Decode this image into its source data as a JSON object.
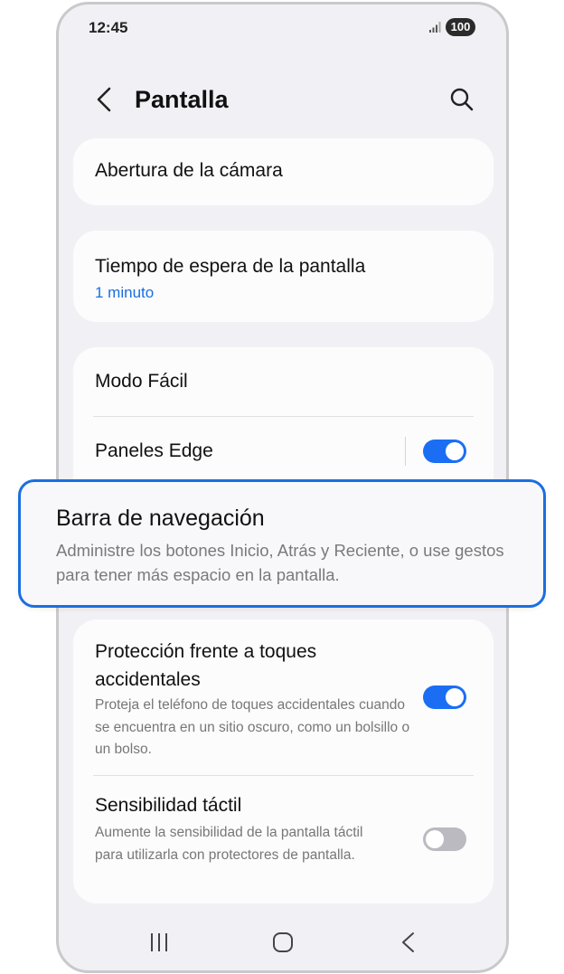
{
  "status_bar": {
    "time": "12:45",
    "battery": "100",
    "signal_icon": "signal-icon"
  },
  "header": {
    "title": "Pantalla",
    "back_icon": "back-icon",
    "search_icon": "search-icon"
  },
  "settings": {
    "camera_cutout": {
      "title": "Abertura de la cámara"
    },
    "screen_timeout": {
      "title": "Tiempo de espera de la pantalla",
      "value": "1 minuto"
    },
    "easy_mode": {
      "title": "Modo Fácil"
    },
    "edge_panels": {
      "title": "Paneles Edge",
      "enabled": true
    },
    "navigation_bar": {
      "title": "Barra de navegación",
      "description": "Administre los botones Inicio, Atrás y Reciente, o use gestos para tener más espacio en la pantalla."
    },
    "accidental_touch": {
      "title": "Protección frente a toques accidentales",
      "description": "Proteja el teléfono de toques accidentales cuando se encuentra en un sitio oscuro, como un bolsillo o un bolso.",
      "enabled": true
    },
    "touch_sensitivity": {
      "title": "Sensibilidad táctil",
      "description": "Aumente la sensibilidad de la pantalla táctil para utilizarla con protectores de pantalla.",
      "enabled": false
    }
  },
  "colors": {
    "accent": "#1a6fe0",
    "toggle_on": "#1b6ef3",
    "toggle_off": "#babac0",
    "background": "#f1f1f5"
  },
  "nav_bar": {
    "recents_icon": "recents-icon",
    "home_icon": "home-icon",
    "back_icon": "back-nav-icon"
  }
}
